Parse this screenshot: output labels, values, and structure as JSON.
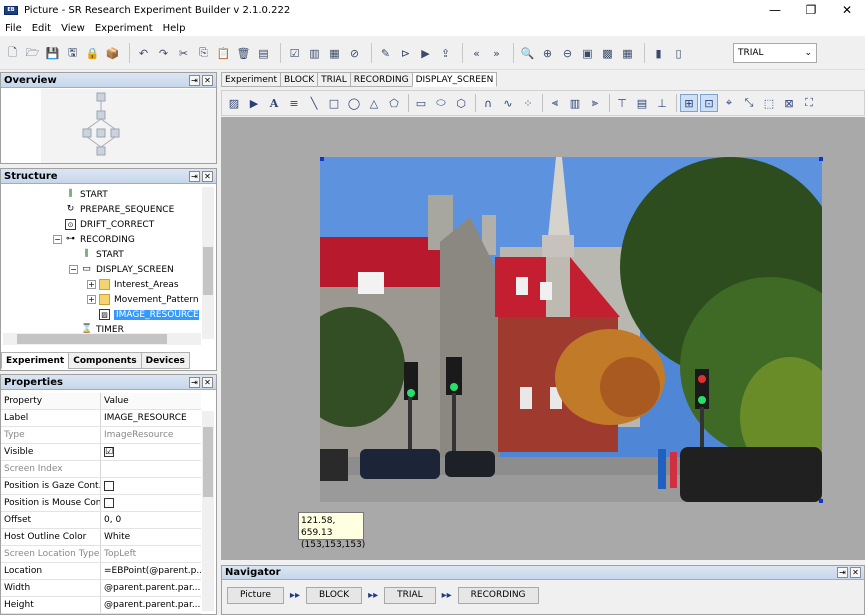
{
  "window": {
    "title": "Picture - SR Research Experiment Builder v 2.1.0.222",
    "minimize": "—",
    "maximize": "❐",
    "close": "✕"
  },
  "menu": [
    "File",
    "Edit",
    "View",
    "Experiment",
    "Help"
  ],
  "toolbar": {
    "trial_select_value": "TRIAL"
  },
  "overview": {
    "title": "Overview"
  },
  "structure": {
    "title": "Structure",
    "items": [
      {
        "label": "START",
        "indent": 3
      },
      {
        "label": "PREPARE_SEQUENCE",
        "indent": 3
      },
      {
        "label": "DRIFT_CORRECT",
        "indent": 3
      },
      {
        "label": "RECORDING",
        "indent": 3
      },
      {
        "label": "START",
        "indent": 4
      },
      {
        "label": "DISPLAY_SCREEN",
        "indent": 4
      },
      {
        "label": "Interest_Areas",
        "indent": 5
      },
      {
        "label": "Movement_Patterns",
        "indent": 5
      },
      {
        "label": "IMAGE_RESOURCE",
        "indent": 5
      },
      {
        "label": "TIMER",
        "indent": 4
      }
    ],
    "tabs": [
      "Experiment",
      "Components",
      "Devices"
    ]
  },
  "properties": {
    "title": "Properties",
    "col_property": "Property",
    "col_value": "Value",
    "rows": [
      {
        "key": "Label",
        "value": "IMAGE_RESOURCE"
      },
      {
        "key": "Type",
        "value": "ImageResource"
      },
      {
        "key": "Visible",
        "value": "☑"
      },
      {
        "key": "Screen Index",
        "value": ""
      },
      {
        "key": "Position is Gaze Cont...",
        "value": ""
      },
      {
        "key": "Position is Mouse Con...",
        "value": ""
      },
      {
        "key": "Offset",
        "value": "0, 0"
      },
      {
        "key": "Host Outline Color",
        "value": "White"
      },
      {
        "key": "Screen Location Type",
        "value": "TopLeft"
      },
      {
        "key": "Location",
        "value": "=EBPoint(@parent.p..."
      },
      {
        "key": "Width",
        "value": "@parent.parent.par..."
      },
      {
        "key": "Height",
        "value": "@parent.parent.par..."
      }
    ]
  },
  "work_tabs": [
    "Experiment",
    "BLOCK",
    "TRIAL",
    "RECORDING",
    "DISPLAY_SCREEN"
  ],
  "canvas": {
    "coord_tooltip_line1": "121.58, 659.13",
    "coord_tooltip_line2": "(153,153,153)"
  },
  "navigator": {
    "title": "Navigator",
    "items": [
      "Picture",
      "BLOCK",
      "TRIAL",
      "RECORDING"
    ]
  },
  "colors": {
    "panel_header": "#c6d6ea",
    "selection": "#3399ff",
    "canvas_bg": "#a9a9a9"
  }
}
